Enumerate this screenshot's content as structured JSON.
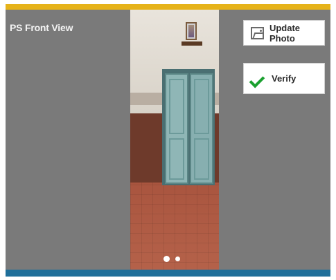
{
  "screen": {
    "title": "PS Front View"
  },
  "photo_viewer": {
    "active_index": 1,
    "total": 2
  },
  "actions": {
    "update_photo_label": "Update Photo",
    "verify_label": "Verify"
  },
  "colors": {
    "top_bar": "#e6b31a",
    "bottom_bar": "#1f6f9a",
    "background": "#7a7a7a",
    "check_green": "#1aa02f"
  },
  "icons": {
    "update_photo": "image-icon",
    "verify": "checkmark-icon"
  }
}
